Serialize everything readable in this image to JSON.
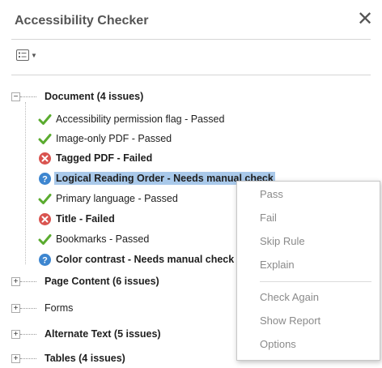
{
  "panel": {
    "title": "Accessibility Checker",
    "close_glyph": "✕"
  },
  "toolbar": {
    "options_icon": "list-options-icon"
  },
  "tree": {
    "document": {
      "label": "Document (4 issues)",
      "items": [
        {
          "label": "Accessibility permission flag - Passed",
          "status": "passed"
        },
        {
          "label": "Image-only PDF - Passed",
          "status": "passed"
        },
        {
          "label": "Tagged PDF - Failed",
          "status": "failed"
        },
        {
          "label": "Logical Reading Order - Needs manual check",
          "status": "manual"
        },
        {
          "label": "Primary language - Passed",
          "status": "passed"
        },
        {
          "label": "Title - Failed",
          "status": "failed"
        },
        {
          "label": "Bookmarks - Passed",
          "status": "passed"
        },
        {
          "label": "Color contrast - Needs manual check",
          "status": "manual"
        }
      ]
    },
    "page_content": {
      "label": "Page Content (6 issues)"
    },
    "forms": {
      "label": "Forms"
    },
    "alt_text": {
      "label": "Alternate Text (5 issues)"
    },
    "tables": {
      "label": "Tables (4 issues)"
    }
  },
  "context_menu": {
    "pass": "Pass",
    "fail": "Fail",
    "skip_rule": "Skip Rule",
    "explain": "Explain",
    "check_again": "Check Again",
    "show_report": "Show Report",
    "options": "Options"
  },
  "colors": {
    "passed": "#5aab2f",
    "failed": "#d9534f",
    "manual": "#3d86d0",
    "selection": "#a9c9ea"
  }
}
